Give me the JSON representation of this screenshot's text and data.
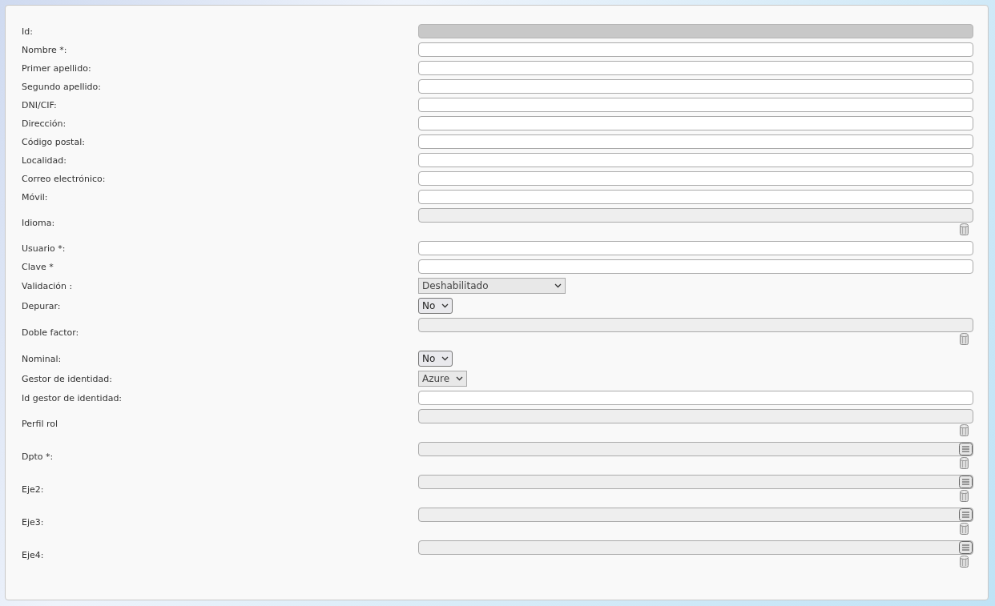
{
  "form": {
    "fields": [
      {
        "label": "Id:",
        "kind": "readonly"
      },
      {
        "label": "Nombre *:",
        "kind": "text"
      },
      {
        "label": "Primer apellido:",
        "kind": "text"
      },
      {
        "label": "Segundo apellido:",
        "kind": "text"
      },
      {
        "label": "DNI/CIF:",
        "kind": "text"
      },
      {
        "label": "Dirección:",
        "kind": "text"
      },
      {
        "label": "Código postal:",
        "kind": "text"
      },
      {
        "label": "Localidad:",
        "kind": "text"
      },
      {
        "label": "Correo electrónico:",
        "kind": "text"
      },
      {
        "label": "Móvil:",
        "kind": "text"
      },
      {
        "label": "Idioma:",
        "kind": "lookup"
      },
      {
        "label": "Usuario *:",
        "kind": "text"
      },
      {
        "label": "Clave *",
        "kind": "text"
      },
      {
        "label": "Validación :",
        "kind": "select_wide",
        "value": "Deshabilitado",
        "disabled": true
      },
      {
        "label": "Depurar:",
        "kind": "select",
        "value": "No",
        "disabled": false
      },
      {
        "label": "Doble factor:",
        "kind": "lookup"
      },
      {
        "label": "Nominal:",
        "kind": "select",
        "value": "No",
        "disabled": false
      },
      {
        "label": "Gestor de identidad:",
        "kind": "select",
        "value": "Azure",
        "disabled": true
      },
      {
        "label": "Id gestor de identidad:",
        "kind": "text"
      },
      {
        "label": "Perfil rol",
        "kind": "lookup"
      },
      {
        "label": "Dpto *:",
        "kind": "lookup_list"
      },
      {
        "label": "Eje2:",
        "kind": "lookup_list"
      },
      {
        "label": "Eje3:",
        "kind": "lookup_list"
      },
      {
        "label": "Eje4:",
        "kind": "lookup_list"
      }
    ]
  }
}
